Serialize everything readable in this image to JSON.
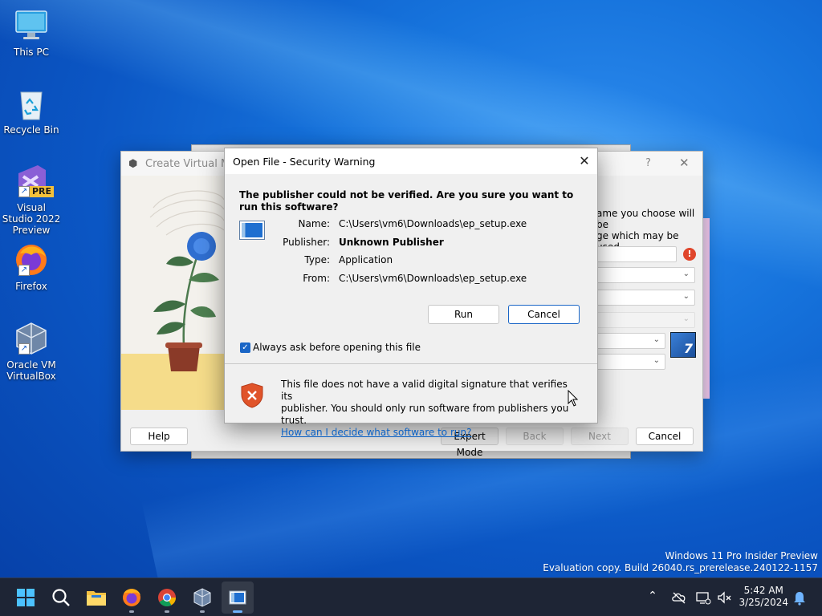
{
  "desktop": {
    "icons": [
      {
        "label": "This PC"
      },
      {
        "label": "Recycle Bin"
      },
      {
        "label": "Visual Studio 2022 Preview",
        "badge": "PRE"
      },
      {
        "label": "Firefox"
      },
      {
        "label": "Oracle VM VirtualBox"
      }
    ]
  },
  "vbox_wizard": {
    "title": "Create Virtual Mac",
    "help_glyph": "?",
    "close_glyph": "✕",
    "side_text_1": "ame you choose will be",
    "side_text_2": "ge which may be used",
    "buttons": {
      "help": "Help",
      "expert": "Expert Mode",
      "back": "Back",
      "next": "Next",
      "cancel": "Cancel"
    },
    "os_badge": "7"
  },
  "dialog": {
    "title": "Open File - Security Warning",
    "close_glyph": "✕",
    "question": "The publisher could not be verified.  Are you sure you want to run this software?",
    "fields": [
      {
        "label": "Name:",
        "value": "C:\\Users\\vm6\\Downloads\\ep_setup.exe",
        "bold": false
      },
      {
        "label": "Publisher:",
        "value": "Unknown Publisher",
        "bold": true
      },
      {
        "label": "Type:",
        "value": "Application",
        "bold": false
      },
      {
        "label": "From:",
        "value": "C:\\Users\\vm6\\Downloads\\ep_setup.exe",
        "bold": false
      }
    ],
    "run_label": "Run",
    "cancel_label": "Cancel",
    "checkbox_label": "Always ask before opening this file",
    "checkbox_checked": true,
    "warning_line1": "This file does not have a valid digital signature that verifies its",
    "warning_line2": "publisher.  You should only run software from publishers you trust.",
    "warning_link": "How can I decide what software to run?"
  },
  "watermark": {
    "line1": "Windows 11 Pro Insider Preview",
    "line2": "Evaluation copy. Build 26040.rs_prerelease.240122-1157"
  },
  "taskbar": {
    "apps": [
      "start-icon",
      "search-icon",
      "file-explorer-icon",
      "firefox-icon",
      "chrome-icon",
      "virtualbox-icon",
      "ep-setup-icon"
    ],
    "time": "5:42 AM",
    "date": "3/25/2024"
  },
  "colors": {
    "accent": "#0b61c5",
    "taskbar": "#1e2535",
    "warning_shield": "#e0542a"
  }
}
